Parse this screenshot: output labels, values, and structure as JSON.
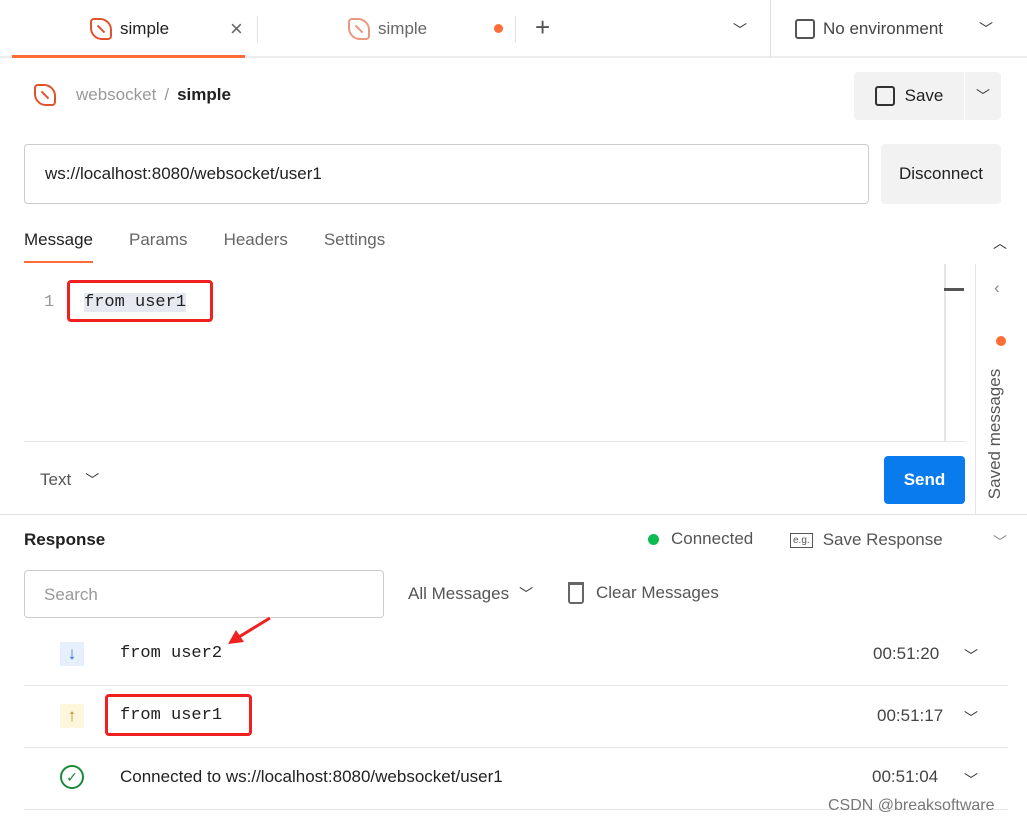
{
  "tabs": [
    {
      "label": "simple",
      "active": true
    },
    {
      "label": "simple",
      "unsaved": true
    }
  ],
  "environment": "No environment",
  "breadcrumb": {
    "collection": "websocket",
    "separator": "/",
    "name": "simple"
  },
  "save_label": "Save",
  "url": "ws://localhost:8080/websocket/user1",
  "disconnect_label": "Disconnect",
  "request_tabs": [
    "Message",
    "Params",
    "Headers",
    "Settings"
  ],
  "editor": {
    "line": "1",
    "text": "from user1"
  },
  "format": "Text",
  "send_label": "Send",
  "saved_messages": "Saved messages",
  "response": {
    "title": "Response",
    "status": "Connected",
    "save_response": "Save Response",
    "eg": "e.g.",
    "search_placeholder": "Search",
    "filter": "All Messages",
    "clear": "Clear Messages",
    "messages": [
      {
        "direction": "incoming",
        "text": "from user2",
        "time": "00:51:20"
      },
      {
        "direction": "outgoing",
        "text": "from user1",
        "time": "00:51:17"
      },
      {
        "direction": "connected",
        "text": "Connected to ws://localhost:8080/websocket/user1",
        "time": "00:51:04"
      }
    ]
  },
  "watermark": "CSDN @breaksoftware",
  "colors": {
    "accent": "#ff6c37",
    "send": "#097bed",
    "connected": "#0cbb52"
  }
}
